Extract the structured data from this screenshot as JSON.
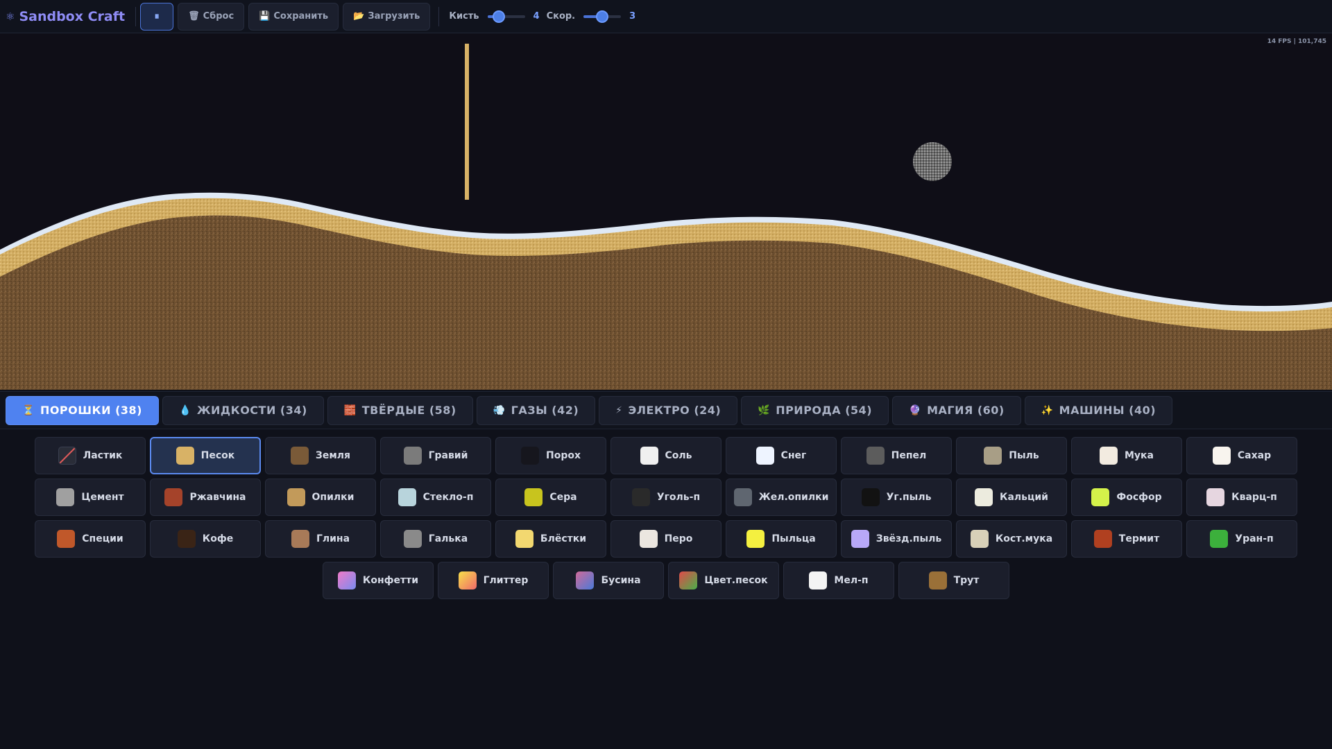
{
  "app": {
    "title": "Sandbox Craft",
    "logo_icon": "atom-icon"
  },
  "toolbar": {
    "pause_label": "⏸",
    "reset_label": "Сброс",
    "save_label": "Сохранить",
    "load_label": "Загрузить",
    "brush_label": "Кисть",
    "brush_value": "4",
    "brush_level": 0.3,
    "speed_label": "Скор.",
    "speed_value": "3",
    "speed_level": 0.5
  },
  "canvas": {
    "fps_text": "14 FPS | 101,745"
  },
  "tabs": [
    {
      "icon": "⏳",
      "label": "ПОРОШКИ (38)",
      "active": true
    },
    {
      "icon": "💧",
      "label": "ЖИДКОСТИ (34)",
      "active": false
    },
    {
      "icon": "🧱",
      "label": "ТВЁРДЫЕ (58)",
      "active": false
    },
    {
      "icon": "💨",
      "label": "ГАЗЫ (42)",
      "active": false
    },
    {
      "icon": "⚡",
      "label": "ЭЛЕКТРО (24)",
      "active": false
    },
    {
      "icon": "🌿",
      "label": "ПРИРОДА (54)",
      "active": false
    },
    {
      "icon": "🔮",
      "label": "МАГИЯ (60)",
      "active": false
    },
    {
      "icon": "✨",
      "label": "МАШИНЫ (40)",
      "active": false
    }
  ],
  "materials": [
    {
      "label": "Ластик",
      "color": "eraser"
    },
    {
      "label": "Песок",
      "color": "#d8b266",
      "selected": true
    },
    {
      "label": "Земля",
      "color": "#7a5a38"
    },
    {
      "label": "Гравий",
      "color": "#7b7b7b"
    },
    {
      "label": "Порох",
      "color": "#16161d"
    },
    {
      "label": "Соль",
      "color": "#f0f0f0"
    },
    {
      "label": "Снег",
      "color": "#eef4ff"
    },
    {
      "label": "Пепел",
      "color": "#5c5c5c"
    },
    {
      "label": "Пыль",
      "color": "#a89e86"
    },
    {
      "label": "Мука",
      "color": "#f2ebe0"
    },
    {
      "label": "Сахар",
      "color": "#f8f4ee"
    },
    {
      "label": "Цемент",
      "color": "#a0a0a0"
    },
    {
      "label": "Ржавчина",
      "color": "#a5432a"
    },
    {
      "label": "Опилки",
      "color": "#c29a5a"
    },
    {
      "label": "Стекло-п",
      "color": "#b8d4dc"
    },
    {
      "label": "Сера",
      "color": "#c8c41e"
    },
    {
      "label": "Уголь-п",
      "color": "#2a2a2a"
    },
    {
      "label": "Жел.опилки",
      "color": "#5f6670"
    },
    {
      "label": "Уг.пыль",
      "color": "#121212"
    },
    {
      "label": "Кальций",
      "color": "#ecebde"
    },
    {
      "label": "Фосфор",
      "color": "#d4f24a"
    },
    {
      "label": "Кварц-п",
      "color": "#e6d6e0"
    },
    {
      "label": "Специи",
      "color": "#c0582a"
    },
    {
      "label": "Кофе",
      "color": "#3a2416"
    },
    {
      "label": "Глина",
      "color": "#a87a58"
    },
    {
      "label": "Галька",
      "color": "#8a8a8a"
    },
    {
      "label": "Блёстки",
      "color": "#f2d870"
    },
    {
      "label": "Перо",
      "color": "#ebe6e0"
    },
    {
      "label": "Пыльца",
      "color": "#f4f040"
    },
    {
      "label": "Звёзд.пыль",
      "color": "#b8a8f8"
    },
    {
      "label": "Кост.мука",
      "color": "#d8d0b8"
    },
    {
      "label": "Термит",
      "color": "#b04020"
    },
    {
      "label": "Уран-п",
      "color": "#3cb03c"
    },
    {
      "label": "Конфетти",
      "color": "linear-gradient(135deg,#f07ac8,#7a8cf0)"
    },
    {
      "label": "Глиттер",
      "color": "linear-gradient(135deg,#f8e04a,#f06a6a)"
    },
    {
      "label": "Бусина",
      "color": "linear-gradient(135deg,#d06a9a,#4a7ad8)"
    },
    {
      "label": "Цвет.песок",
      "color": "linear-gradient(135deg,#e04a4a,#4ab04a)"
    },
    {
      "label": "Мел-п",
      "color": "#f4f4f4"
    },
    {
      "label": "Трут",
      "color": "#9a7038"
    }
  ]
}
